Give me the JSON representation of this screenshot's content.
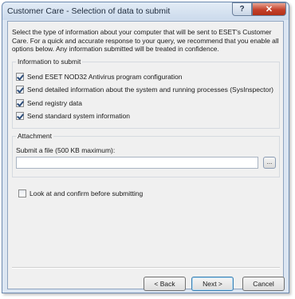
{
  "window": {
    "title": "Customer Care - Selection of data to submit",
    "help_label": "?",
    "close_label": "✕"
  },
  "description": "Select the type of information about your computer that will be sent to ESET's Customer Care. For a quick and accurate response to your query, we recommend that you enable all options below. Any information submitted will be treated in confidence.",
  "info_group": {
    "legend": "Information to submit",
    "options": [
      {
        "label": "Send ESET NOD32 Antivirus program configuration",
        "checked": true
      },
      {
        "label": "Send detailed information about the system and running processes (SysInspector)",
        "checked": true
      },
      {
        "label": "Send registry data",
        "checked": true
      },
      {
        "label": "Send standard system information",
        "checked": true
      }
    ]
  },
  "attachment": {
    "legend": "Attachment",
    "file_label": "Submit a file (500 KB maximum):",
    "file_value": "",
    "browse_label": "..."
  },
  "confirm": {
    "label": "Look at and confirm before submitting",
    "checked": false
  },
  "buttons": {
    "back": "< Back",
    "next": "Next >",
    "cancel": "Cancel"
  }
}
